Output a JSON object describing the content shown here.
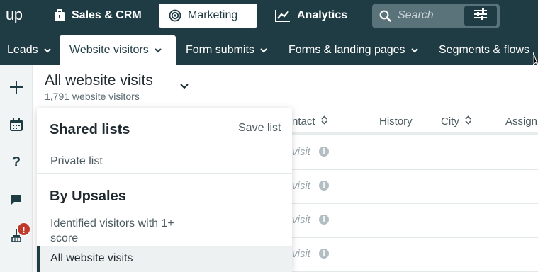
{
  "app": {
    "logo": "up"
  },
  "topnav": {
    "items": [
      {
        "label": "Sales & CRM",
        "icon": "briefcase-icon"
      },
      {
        "label": "Marketing",
        "icon": "target-icon",
        "active": true
      },
      {
        "label": "Analytics",
        "icon": "chart-line-icon"
      }
    ],
    "search_placeholder": "Search"
  },
  "tabs": [
    {
      "label": "Leads"
    },
    {
      "label": "Website visitors",
      "active": true
    },
    {
      "label": "Form submits"
    },
    {
      "label": "Forms & landing pages"
    },
    {
      "label": "Segments & flows"
    }
  ],
  "sidebar": {
    "icons": [
      "plus-icon",
      "calendar-icon",
      "help-icon",
      "chat-icon",
      "broom-icon"
    ],
    "alert_badge": "!"
  },
  "header": {
    "title": "All website visits",
    "subtitle": "1,791 website visitors"
  },
  "table": {
    "columns": [
      "ntact",
      "History",
      "City",
      "Assign"
    ],
    "rows": [
      {
        "visit": "visit",
        "info": "i"
      },
      {
        "visit": "visit",
        "info": "i"
      },
      {
        "visit": "visit",
        "info": "i"
      },
      {
        "visit": "visit",
        "info": "i"
      }
    ]
  },
  "dropdown": {
    "shared_heading": "Shared lists",
    "save_label": "Save list",
    "private_item": "Private list",
    "upsales_heading": "By Upsales",
    "identified_item": "Identified visitors with 1+ score",
    "selected_item": "All website visits"
  },
  "colors": {
    "nav_bg": "#1f3b44",
    "search_bg": "#5a7279",
    "alert_red": "#c0392b"
  }
}
